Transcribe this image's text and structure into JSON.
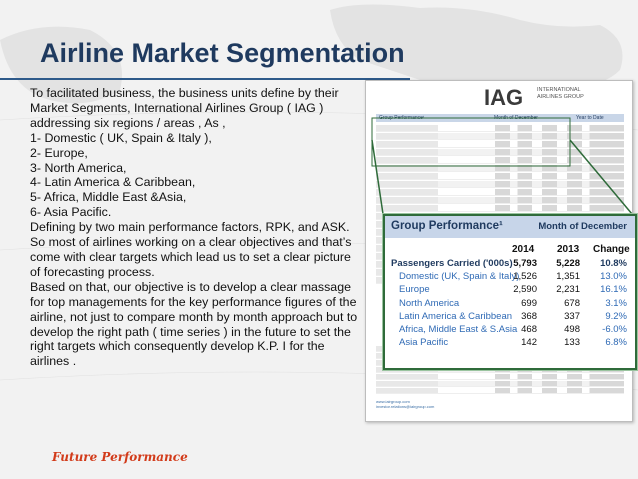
{
  "slide": {
    "title": "Airline Market Segmentation",
    "paragraphs": [
      "To facilitated business, the business units define by their Market Segments,  International Airlines Group ( IAG ) addressing six  regions / areas ,  As ,",
      "1- Domestic ( UK, Spain & Italy ),",
      "2-  Europe,",
      "3- North America,",
      "4- Latin America & Caribbean,",
      "5- Africa, Middle East &Asia,",
      "6- Asia Pacific.",
      " Defining by two main performance factors,  RPK, and ASK.",
      "So most of airlines  working on a clear objectives and that’s come with clear targets which lead us to set a clear picture of forecasting process.",
      "Based on that, our objective is to develop a clear massage for top managements for the key performance figures of the airline, not just to compare month by month approach but to develop the right path ( time series ) in the future to set the right targets which consequently develop  K.P. I for the airlines ."
    ],
    "footer": "Future Performance"
  },
  "report": {
    "logo": "IAG",
    "logo_sub": "International Airlines Group",
    "panel_title": "Group Performance¹",
    "panel_period": "Month of December",
    "columns": [
      "2014",
      "2013",
      "Change"
    ],
    "rows": [
      {
        "label": "Passengers Carried ('000s)",
        "v2014": "5,793",
        "v2013": "5,228",
        "change": "10.8%",
        "main": true
      },
      {
        "label": "Domestic (UK, Spain & Italy)",
        "v2014": "1,526",
        "v2013": "1,351",
        "change": "13.0%",
        "main": false
      },
      {
        "label": "Europe",
        "v2014": "2,590",
        "v2013": "2,231",
        "change": "16.1%",
        "main": false
      },
      {
        "label": "North America",
        "v2014": "699",
        "v2013": "678",
        "change": "3.1%",
        "main": false
      },
      {
        "label": "Latin America & Caribbean",
        "v2014": "368",
        "v2013": "337",
        "change": "9.2%",
        "main": false
      },
      {
        "label": "Africa, Middle East & S.Asia",
        "v2014": "468",
        "v2013": "498",
        "change": "-6.0%",
        "main": false
      },
      {
        "label": "Asia Pacific",
        "v2014": "142",
        "v2013": "133",
        "change": "6.8%",
        "main": false
      }
    ],
    "mini_header_left": "Group Performance¹",
    "mini_header_mid": "Month of December",
    "mini_header_right": "Year to Date",
    "mini_note_left": "www.iairgroup.com",
    "mini_note_right": "investor.relations@iairgroup.com"
  },
  "colors": {
    "title": "#1f3a5f",
    "footer": "#d23b1a",
    "panel_header": "#c7d5e9",
    "region_label": "#2f6ab5",
    "connector": "#2f6b3a"
  }
}
